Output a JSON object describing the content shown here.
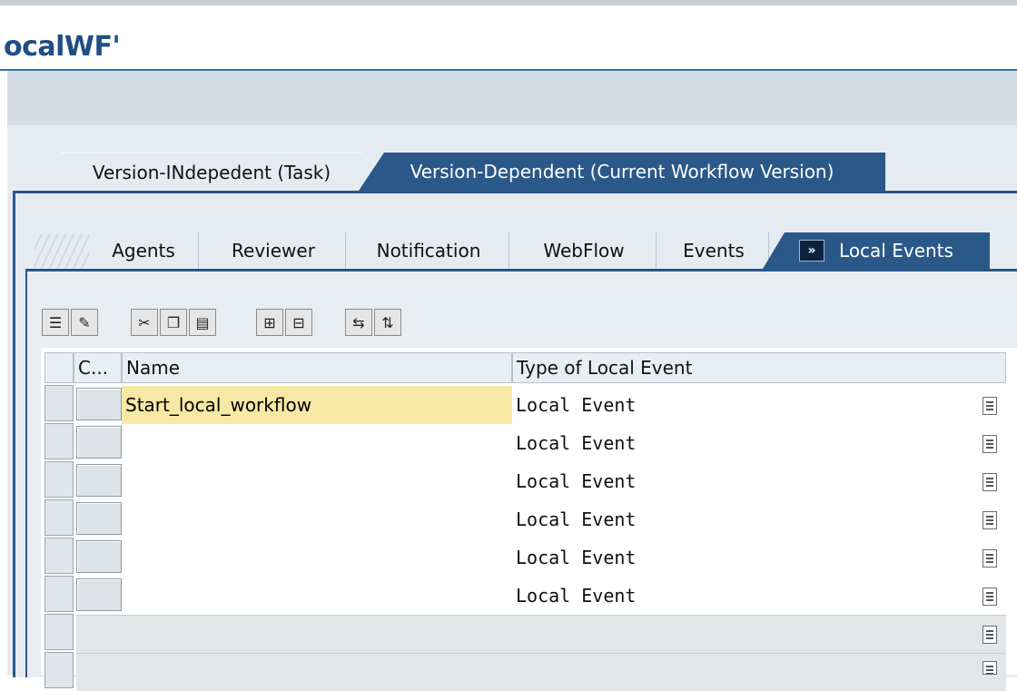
{
  "window": {
    "title": "ocalWF'"
  },
  "outer_tabs": [
    {
      "label": "Version-INdepedent (Task)"
    },
    {
      "label": "Version-Dependent (Current Workflow Version)"
    }
  ],
  "inner_tabs": [
    {
      "label": "Agents"
    },
    {
      "label": "Reviewer"
    },
    {
      "label": "Notification"
    },
    {
      "label": "WebFlow"
    },
    {
      "label": "Events"
    },
    {
      "label": "Local Events",
      "icon": "local-events-icon"
    }
  ],
  "table": {
    "columns": [
      "C...",
      "Name",
      "Type of Local Event"
    ],
    "rows": [
      {
        "name": "Start_local_workflow",
        "type": "Local Event"
      },
      {
        "name": "",
        "type": "Local Event"
      },
      {
        "name": "",
        "type": "Local Event"
      },
      {
        "name": "",
        "type": "Local Event"
      },
      {
        "name": "",
        "type": "Local Event"
      },
      {
        "name": "",
        "type": "Local Event"
      }
    ]
  },
  "toolbar_icons": [
    "detail-icon",
    "edit-icon",
    "cut-icon",
    "copy-icon",
    "paste-icon",
    "insert-row-icon",
    "delete-row-icon",
    "export-icon",
    "import-icon"
  ],
  "colors": {
    "tab_active": "#2a5888",
    "title": "#1f4f84",
    "selected_cell": "#f7e8a4"
  }
}
